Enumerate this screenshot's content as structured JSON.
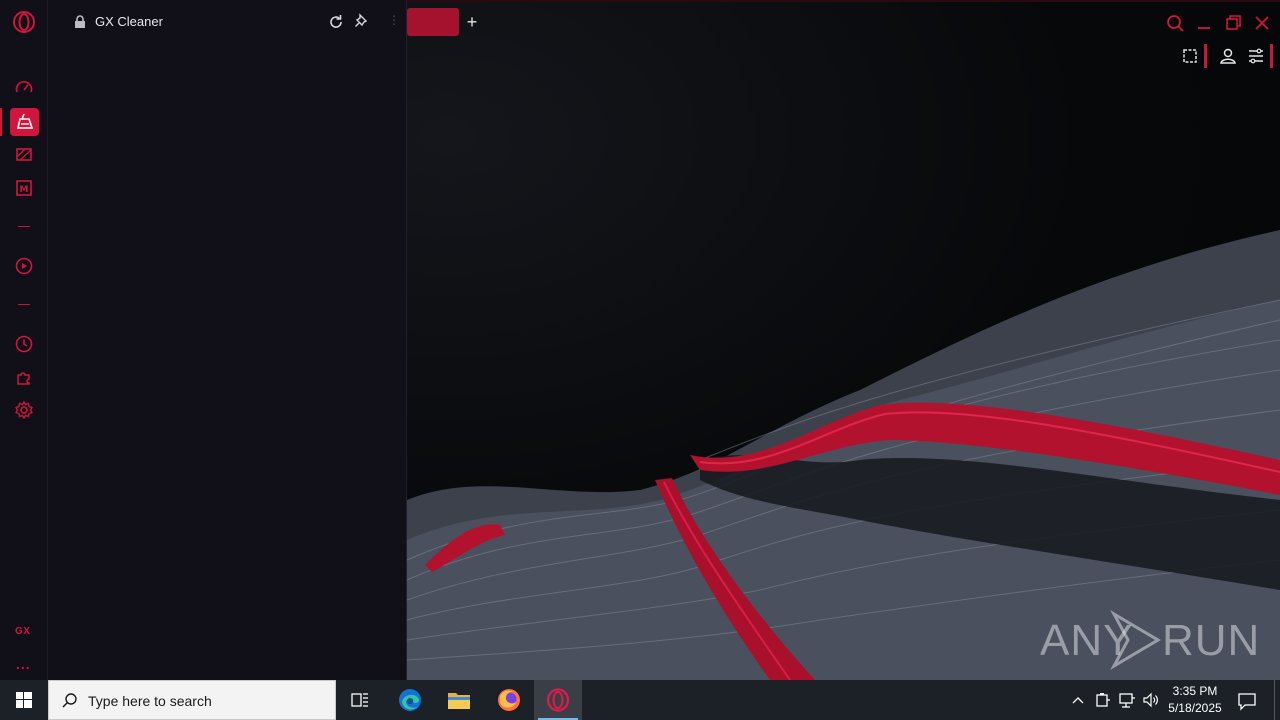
{
  "browser": {
    "panel_title": "GX Cleaner",
    "accent_color": "#d0163c",
    "sidebar": {
      "items": [
        {
          "icon": "speed-dial-icon"
        },
        {
          "icon": "gx-cleaner-icon",
          "active": true
        },
        {
          "icon": "gx-control-icon"
        },
        {
          "icon": "gx-corner-icon"
        },
        {
          "icon": "player-icon"
        },
        {
          "icon": "history-icon"
        },
        {
          "icon": "extensions-icon"
        },
        {
          "icon": "settings-icon"
        }
      ],
      "gx_label": "GX",
      "more_label": "..."
    },
    "toolbar": {
      "new_tab_label": "+"
    }
  },
  "watermark": {
    "left": "ANY",
    "right": "RUN"
  },
  "taskbar": {
    "search_placeholder": "Type here to search",
    "apps": [
      "task-view-icon",
      "edge-icon",
      "file-explorer-icon",
      "firefox-icon",
      "opera-gx-icon"
    ],
    "time": "3:35 PM",
    "date": "5/18/2025"
  }
}
